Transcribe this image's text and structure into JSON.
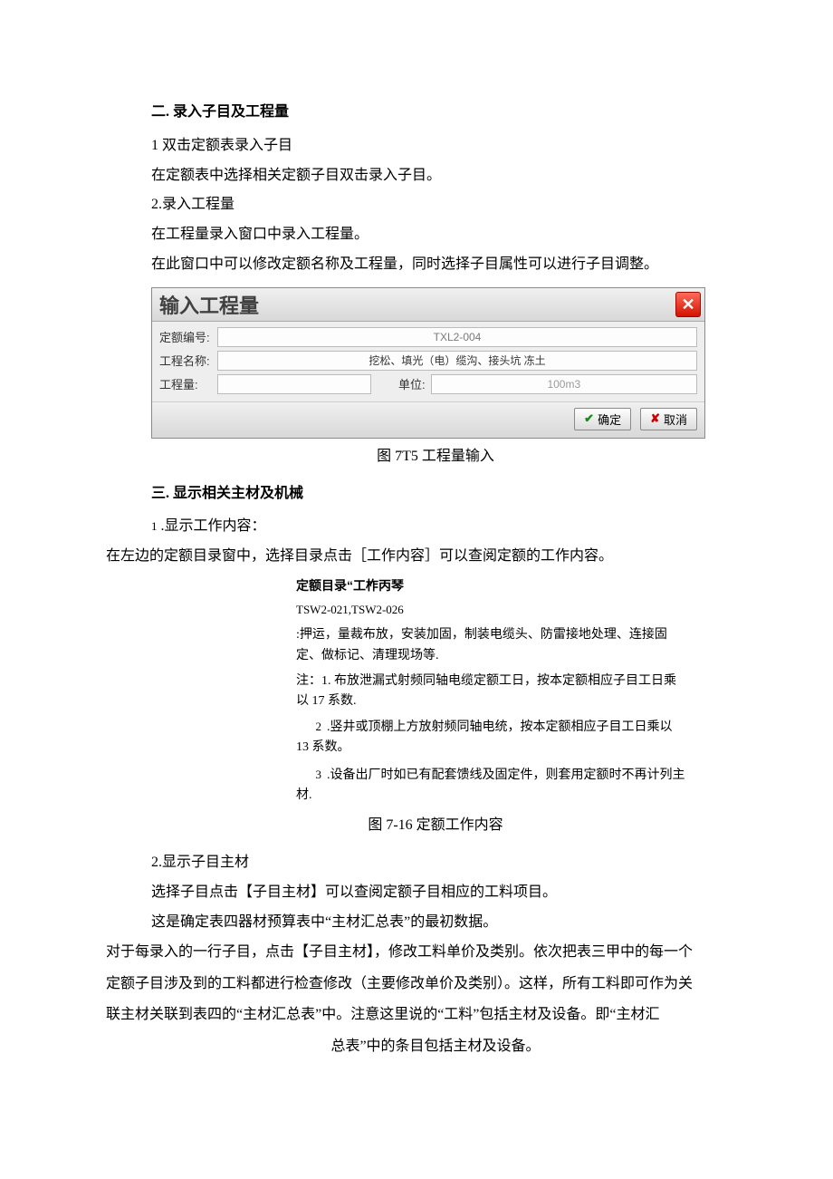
{
  "section2": {
    "heading": "二. 录入子目及工程量",
    "sub1_heading": "1 双击定额表录入子目",
    "sub1_body": "在定额表中选择相关定额子目双击录入子目。",
    "sub2_heading": "2.录入工程量",
    "sub2_body1": "在工程量录入窗口中录入工程量。",
    "sub2_body2": "在此窗口中可以修改定额名称及工程量，同时选择子目属性可以进行子目调整。"
  },
  "dialog": {
    "title": "输入工程量",
    "close_glyph": "✕",
    "row1_label": "定额编号:",
    "row1_value": "TXL2-004",
    "row2_label": "工程名称:",
    "row2_value": "挖松、填光（电）缆沟、接头坑 冻土",
    "row3_label": "工程量:",
    "row3_value": "",
    "row3_unit_label": "单位:",
    "row3_unit_value": "100m3",
    "ok_label": "确定",
    "cancel_label": "取消"
  },
  "fig1_caption": "图 7T5 工程量输入",
  "section3": {
    "heading": "三. 显示相关主材及机械",
    "sub1_heading_num": "1",
    "sub1_heading_text": ".显示工作内容：",
    "sub1_body": "在左边的定额目录窗中，选择目录点击［工作内容］可以查阅定额的工作内容。"
  },
  "work_content": {
    "title": "定额目录“工柞丙琴",
    "codes": "TSW2-021,TSW2-026",
    "desc": ":押运，量裁布放，安装加固，制装电缆头、防雷接地处理、连接固定、做标记、清理现场等.",
    "note_lead": "注：1. 布放泄漏式射频同轴电缆定额工日，按本定额相应子目工日乘以 17 系数.",
    "note2_num": "2",
    "note2_text": ".竖井或顶棚上方放射频同轴电统，按本定额相应子目工日乘以 13 系数。",
    "note3_num": "3",
    "note3_text": ".设备出厂时如已有配套馈线及固定件，则套用定额时不再计列主材."
  },
  "fig2_caption": "图 7-16 定额工作内容",
  "section3_sub2": {
    "heading": "2.显示子目主材",
    "body1": "选择子目点击【子目主材】可以查阅定额子目相应的工料项目。",
    "body2": "这是确定表四器材预算表中“主材汇总表”的最初数据。",
    "para_long1": "对于每录入的一行子目，点击【子目主材】，修改工料单价及类别。依次把表三甲中的每一个",
    "para_long2": "定额子目涉及到的工料都进行检查修改（主要修改单价及类别）。这样，所有工料即可作为关",
    "para_long3": "联主材关联到表四的“主材汇总表”中。注意这里说的“工料”包括主材及设备。即“主材汇",
    "para_center": "总表”中的条目包括主材及设备。"
  }
}
